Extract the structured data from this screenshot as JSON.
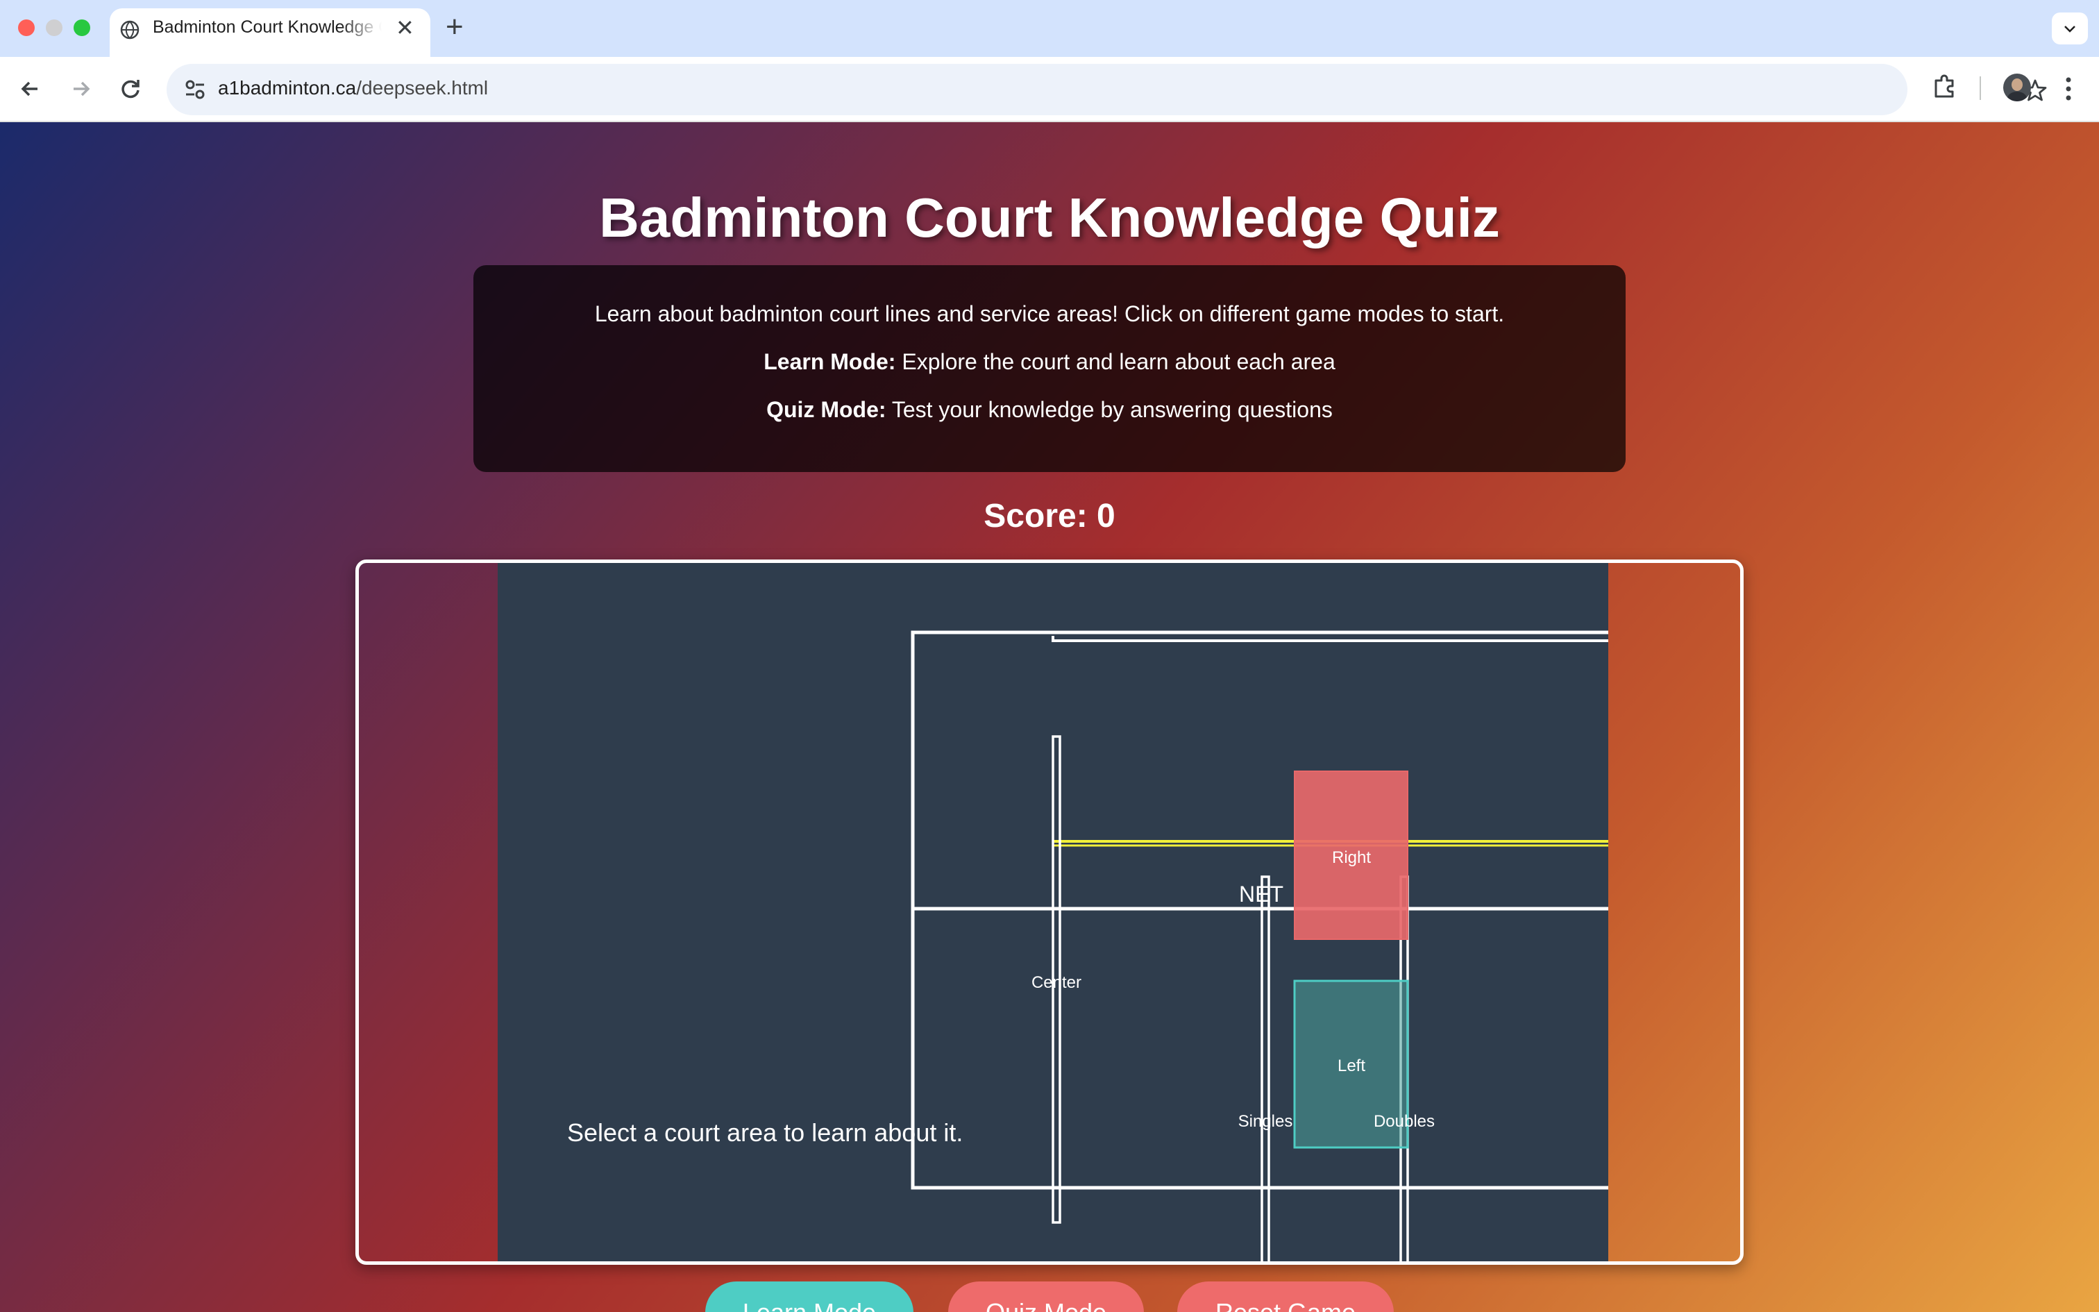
{
  "browser": {
    "tab_title": "Badminton Court Knowledge Quiz",
    "url_host": "a1badminton.ca",
    "url_path": "/deepseek.html",
    "icons": {
      "favicon": "globe-icon",
      "close": "close-icon",
      "new_tab": "plus-icon",
      "tab_search": "chevron-down-icon",
      "back": "back-arrow-icon",
      "forward": "forward-arrow-icon",
      "reload": "reload-icon",
      "site_info": "tune-icon",
      "bookmark": "star-icon",
      "extensions": "puzzle-icon",
      "profile": "avatar",
      "menu": "kebab-menu-icon"
    }
  },
  "page": {
    "title": "Badminton Court Knowledge Quiz",
    "intro": {
      "line1": "Learn about badminton court lines and service areas! Click on different game modes to start.",
      "learn_label": "Learn Mode:",
      "learn_text": " Explore the court and learn about each area",
      "quiz_label": "Quiz Mode:",
      "quiz_text": " Test your knowledge by answering questions"
    },
    "score_label": "Score: ",
    "score_value": "0",
    "court": {
      "labels": {
        "net": "NET",
        "right": "Right",
        "left": "Left",
        "center": "Center",
        "singles": "Singles",
        "doubles": "Doubles"
      },
      "message": "Select a court area to learn about it.",
      "colors": {
        "background": "#2f3d4d",
        "lines": "#ffffff",
        "highlight_line": "#f1f03a",
        "right_service": "#e8686a",
        "left_service": "#4aa39c"
      }
    },
    "buttons": {
      "learn": "Learn Mode",
      "quiz": "Quiz Mode",
      "reset": "Reset Game"
    },
    "colors": {
      "learn_button": "#4ecdc4",
      "quiz_button": "#ee6b6b",
      "reset_button": "#ee6b6b"
    }
  }
}
